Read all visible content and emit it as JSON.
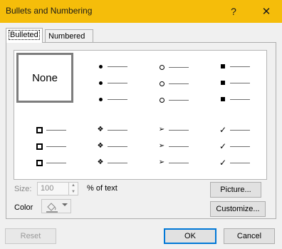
{
  "window": {
    "title": "Bullets and Numbering",
    "help_glyph": "?",
    "close_glyph": "✕"
  },
  "tabs": [
    {
      "label": "Bulleted",
      "selected": true
    },
    {
      "label": "Numbered",
      "selected": false
    }
  ],
  "gallery": {
    "none_label": "None",
    "selected": "None",
    "styles": [
      {
        "icon": "filled-round-bullet-icon"
      },
      {
        "icon": "hollow-round-bullet-icon"
      },
      {
        "icon": "filled-square-bullet-icon"
      },
      {
        "icon": "hollow-square-bullet-icon"
      },
      {
        "icon": "diamond-star-bullet-icon",
        "glyph": "❖"
      },
      {
        "icon": "arrowhead-bullet-icon",
        "glyph": "➢"
      },
      {
        "icon": "checkmark-bullet-icon",
        "glyph": "✓"
      }
    ]
  },
  "size": {
    "label": "Size:",
    "value": "100",
    "unit": "% of text"
  },
  "color": {
    "label": "Color",
    "icon": "paint-bucket-icon",
    "dropdown_icon": "chevron-down-icon"
  },
  "buttons": {
    "picture": "Picture...",
    "customize": "Customize...",
    "reset": "Reset",
    "ok": "OK",
    "cancel": "Cancel"
  },
  "colors": {
    "titlebar": "#f5bd0a",
    "default_button_border": "#0078d7"
  }
}
